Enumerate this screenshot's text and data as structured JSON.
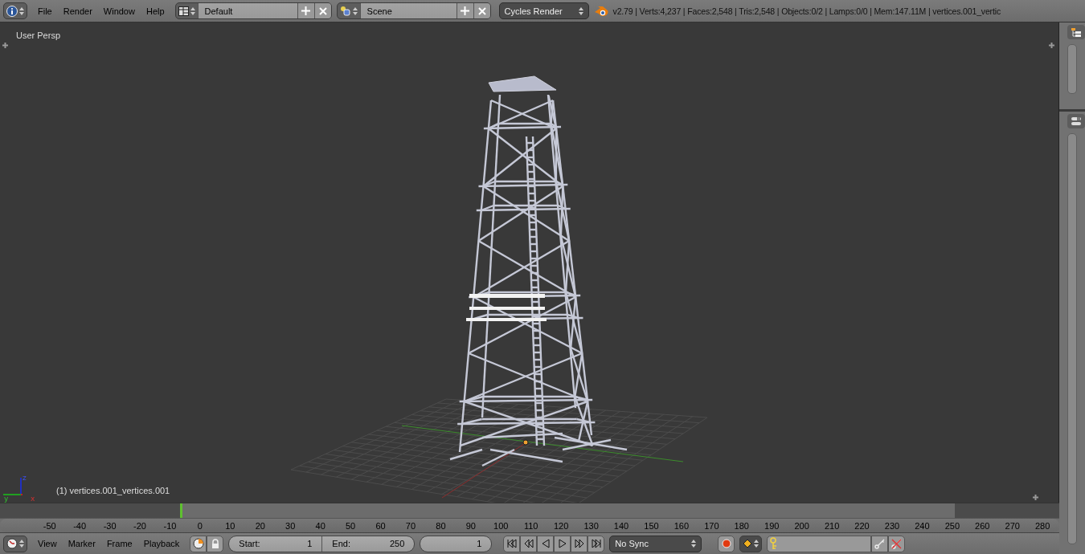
{
  "header": {
    "menus": [
      "File",
      "Render",
      "Window",
      "Help"
    ],
    "layout": {
      "value": "Default"
    },
    "scene": {
      "value": "Scene"
    },
    "render_engine": "Cycles Render",
    "stats": "v2.79 | Verts:4,237 | Faces:2,548 | Tris:2,548 | Objects:0/2 | Lamps:0/0 | Mem:147.11M | vertices.001_vertic"
  },
  "viewport": {
    "view_name": "User Persp",
    "object_label": "(1) vertices.001_vertices.001",
    "axes": {
      "z": "z",
      "y": "y",
      "x": "x"
    }
  },
  "timeline": {
    "ticks": [
      "-50",
      "-40",
      "-30",
      "-20",
      "-10",
      "0",
      "10",
      "20",
      "30",
      "40",
      "50",
      "60",
      "70",
      "80",
      "90",
      "100",
      "110",
      "120",
      "130",
      "140",
      "150",
      "160",
      "170",
      "180",
      "190",
      "200",
      "210",
      "220",
      "230",
      "240",
      "250",
      "260",
      "270",
      "280"
    ],
    "menus": [
      "View",
      "Marker",
      "Frame",
      "Playback"
    ],
    "start": {
      "label": "Start:",
      "value": "1"
    },
    "end": {
      "label": "End:",
      "value": "250"
    },
    "current_frame": "1",
    "sync": "No Sync"
  }
}
